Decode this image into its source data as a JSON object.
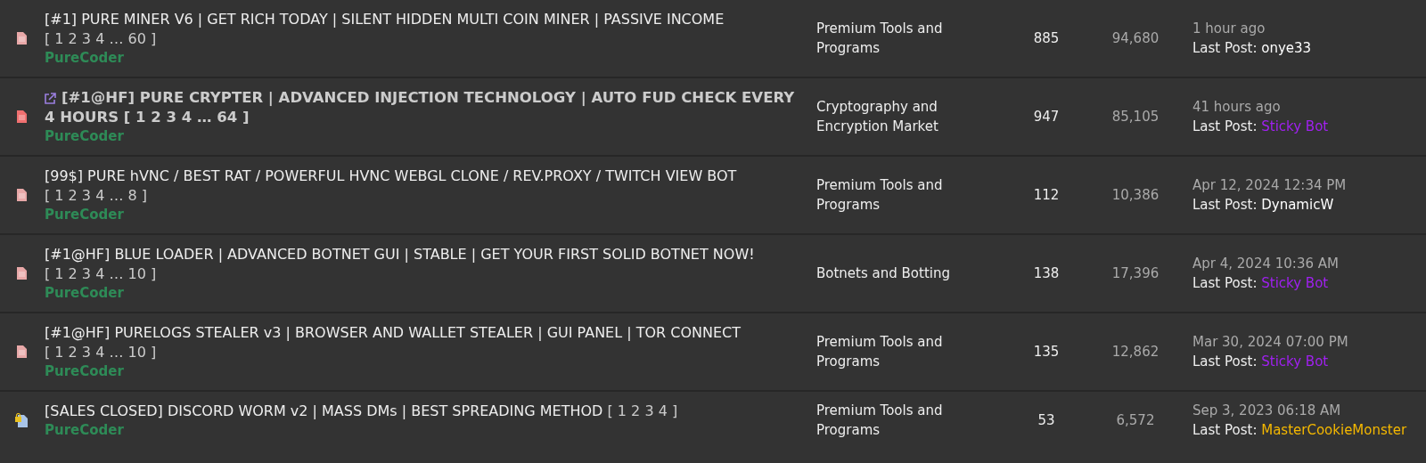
{
  "threads": [
    {
      "kind": "doc",
      "external": false,
      "bold": false,
      "title": "[#1] PURE MINER V6 | GET RICH TODAY | SILENT HIDDEN MULTI COIN MINER | PASSIVE INCOME",
      "pages": "[ 1 2 3 4 … 60 ]",
      "author": "PureCoder",
      "forum": "Premium Tools and Programs",
      "replies": "885",
      "views": "94,680",
      "time": "1 hour ago",
      "last_label": "Last Post:",
      "last_poster": "onye33",
      "color": "#ffffff"
    },
    {
      "kind": "hot",
      "external": true,
      "bold": true,
      "title": "[#1@HF] PURE CRYPTER | ADVANCED INJECTION TECHNOLOGY | AUTO FUD CHECK EVERY 4 HOURS",
      "pages": "[ 1 2 3 4 … 64 ]",
      "author": "PureCoder",
      "forum": "Cryptography and Encryption Market",
      "replies": "947",
      "views": "85,105",
      "time": "41 hours ago",
      "last_label": "Last Post:",
      "last_poster": "Sticky Bot",
      "color": "#a020f0"
    },
    {
      "kind": "doc",
      "external": false,
      "bold": false,
      "title": "[99$] PURE hVNC / BEST RAT / POWERFUL HVNC WEBGL CLONE / REV.PROXY / TWITCH VIEW BOT",
      "pages": "[ 1 2 3 4 … 8 ]",
      "author": "PureCoder",
      "forum": "Premium Tools and Programs",
      "replies": "112",
      "views": "10,386",
      "time": "Apr 12, 2024 12:34 PM",
      "last_label": "Last Post:",
      "last_poster": "DynamicW",
      "color": "#ffffff"
    },
    {
      "kind": "doc",
      "external": false,
      "bold": false,
      "title": "[#1@HF] BLUE LOADER | ADVANCED BOTNET GUI | STABLE | GET YOUR FIRST SOLID BOTNET NOW!",
      "pages": "[ 1 2 3 4 … 10 ]",
      "author": "PureCoder",
      "forum": "Botnets and Botting",
      "replies": "138",
      "views": "17,396",
      "time": "Apr 4, 2024 10:36 AM",
      "last_label": "Last Post:",
      "last_poster": "Sticky Bot",
      "color": "#a020f0"
    },
    {
      "kind": "doc",
      "external": false,
      "bold": false,
      "title": "[#1@HF] PURELOGS STEALER v3 | BROWSER AND WALLET STEALER | GUI PANEL | TOR CONNECT",
      "pages": "[ 1 2 3 4 … 10 ]",
      "author": "PureCoder",
      "forum": "Premium Tools and Programs",
      "replies": "135",
      "views": "12,862",
      "time": "Mar 30, 2024 07:00 PM",
      "last_label": "Last Post:",
      "last_poster": "Sticky Bot",
      "color": "#a020f0"
    },
    {
      "kind": "locked",
      "external": false,
      "bold": false,
      "title": "[SALES CLOSED] DISCORD WORM v2 | MASS DMs | BEST SPREADING METHOD",
      "pages": "[ 1 2 3 4 ]",
      "author": "PureCoder",
      "forum": "Premium Tools and Programs",
      "replies": "53",
      "views": "6,572",
      "time": "Sep 3, 2023 06:18 AM",
      "last_label": "Last Post:",
      "last_poster": "MasterCookieMonster",
      "color": "#f5b800"
    }
  ]
}
